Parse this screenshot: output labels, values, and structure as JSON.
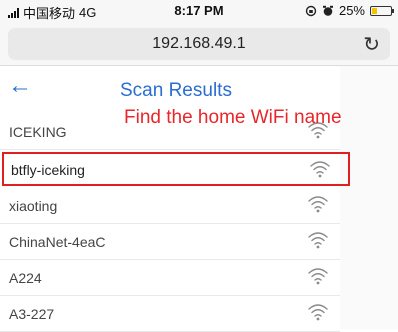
{
  "status_bar": {
    "carrier": "中国移动",
    "network": "4G",
    "time": "8:17 PM",
    "battery_percent": "25%",
    "battery_level": 0.25
  },
  "browser": {
    "url": "192.168.49.1",
    "reload_icon": "reload-icon"
  },
  "page": {
    "back_icon": "back-arrow-icon",
    "title": "Scan Results",
    "annotation": "Find the home WiFi name",
    "accent_color": "#2a6ecf",
    "annotation_color": "#e8262b"
  },
  "networks": [
    {
      "name": "ICEKING"
    },
    {
      "name": "btfly-iceking",
      "highlighted": true
    },
    {
      "name": "xiaoting"
    },
    {
      "name": "ChinaNet-4eaC"
    },
    {
      "name": "A224"
    },
    {
      "name": "A3-227"
    }
  ]
}
